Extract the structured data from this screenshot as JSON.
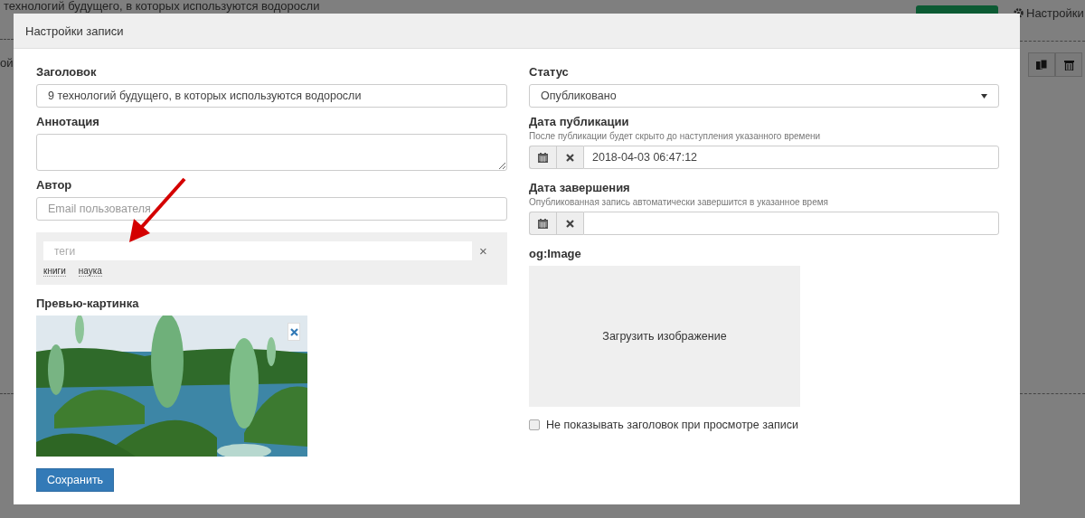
{
  "background_page": {
    "title_fragment": "технологий будущего, в которых используются водоросли",
    "left_fragment": "ой",
    "settings_link": "Настройки"
  },
  "dialog": {
    "title": "Настройки записи"
  },
  "left": {
    "title_field": {
      "label": "Заголовок",
      "value": "9 технологий будущего, в которых используются водоросли"
    },
    "annotation_field": {
      "label": "Аннотация"
    },
    "author_field": {
      "label": "Автор",
      "placeholder": "Email пользователя"
    },
    "tags": {
      "placeholder": "теги",
      "clear": "×",
      "items": [
        "книги",
        "наука"
      ]
    },
    "preview": {
      "label": "Превью-картинка",
      "kind": "picture"
    },
    "save_button": "Сохранить"
  },
  "right": {
    "status": {
      "label": "Статус",
      "value": "Опубликовано"
    },
    "publish_date": {
      "label": "Дата публикации",
      "hint": "После публикации будет скрыто до наступления указанного времени",
      "value": "2018-04-03 06:47:12"
    },
    "end_date": {
      "label": "Дата завершения",
      "hint": "Опубликованная запись автоматически завершится в указанное время"
    },
    "og_image": {
      "label": "og:Image",
      "upload_text": "Загрузить изображение"
    },
    "hide_title": {
      "label": "Не показывать заголовок при просмотре записи",
      "checked": false
    }
  }
}
